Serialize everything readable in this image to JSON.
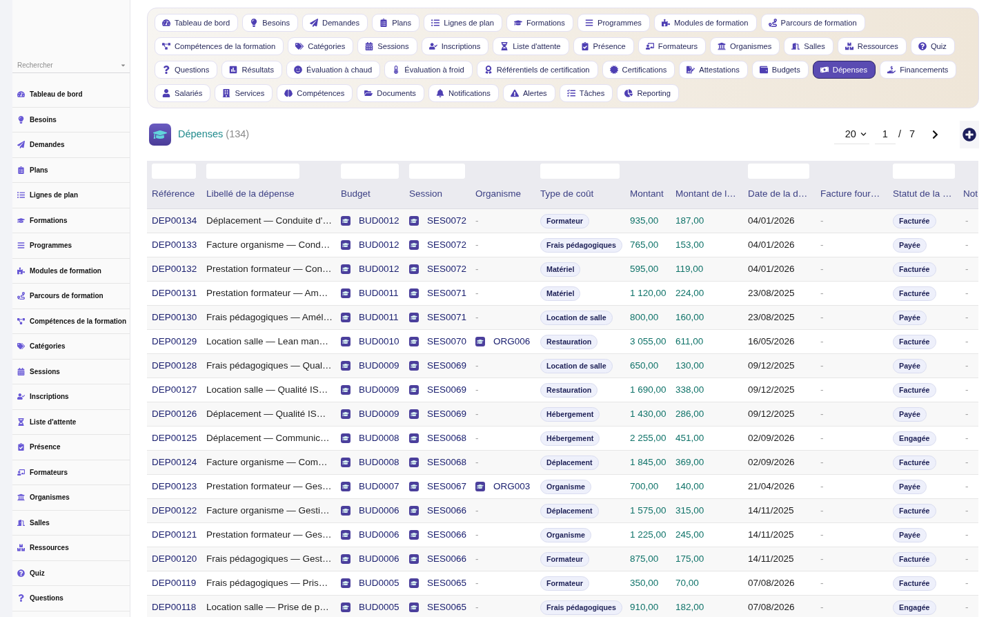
{
  "sidebar": {
    "search": {
      "placeholder": "Rechercher"
    },
    "items": [
      {
        "label": "Tableau de bord"
      },
      {
        "label": "Besoins"
      },
      {
        "label": "Demandes"
      },
      {
        "label": "Plans"
      },
      {
        "label": "Lignes de plan"
      },
      {
        "label": "Formations"
      },
      {
        "label": "Programmes"
      },
      {
        "label": "Modules de formation"
      },
      {
        "label": "Parcours de formation"
      },
      {
        "label": "Compétences de la formation"
      },
      {
        "label": "Catégories"
      },
      {
        "label": "Sessions"
      },
      {
        "label": "Inscriptions"
      },
      {
        "label": "Liste d'attente"
      },
      {
        "label": "Présence"
      },
      {
        "label": "Formateurs"
      },
      {
        "label": "Organismes"
      },
      {
        "label": "Salles"
      },
      {
        "label": "Ressources"
      },
      {
        "label": "Quiz"
      },
      {
        "label": "Questions"
      }
    ]
  },
  "nav": {
    "tabs": [
      {
        "label": "Tableau de bord",
        "selected": false
      },
      {
        "label": "Besoins",
        "selected": false
      },
      {
        "label": "Demandes",
        "selected": false
      },
      {
        "label": "Plans",
        "selected": false
      },
      {
        "label": "Lignes de plan",
        "selected": false
      },
      {
        "label": "Formations",
        "selected": false
      },
      {
        "label": "Programmes",
        "selected": false
      },
      {
        "label": "Modules de formation",
        "selected": false
      },
      {
        "label": "Parcours de formation",
        "selected": false
      },
      {
        "label": "Compétences de la formation",
        "selected": false
      },
      {
        "label": "Catégories",
        "selected": false
      },
      {
        "label": "Sessions",
        "selected": false
      },
      {
        "label": "Inscriptions",
        "selected": false
      },
      {
        "label": "Liste d'attente",
        "selected": false
      },
      {
        "label": "Présence",
        "selected": false
      },
      {
        "label": "Formateurs",
        "selected": false
      },
      {
        "label": "Organismes",
        "selected": false
      },
      {
        "label": "Salles",
        "selected": false
      },
      {
        "label": "Ressources",
        "selected": false
      },
      {
        "label": "Quiz",
        "selected": false
      },
      {
        "label": "Questions",
        "selected": false
      },
      {
        "label": "Résultats",
        "selected": false
      },
      {
        "label": "Évaluation à chaud",
        "selected": false
      },
      {
        "label": "Évaluation à froid",
        "selected": false
      },
      {
        "label": "Référentiels de certification",
        "selected": false
      },
      {
        "label": "Certifications",
        "selected": false
      },
      {
        "label": "Attestations",
        "selected": false
      },
      {
        "label": "Budgets",
        "selected": false
      },
      {
        "label": "Dépenses",
        "selected": true
      },
      {
        "label": "Financements",
        "selected": false
      },
      {
        "label": "Salariés",
        "selected": false
      },
      {
        "label": "Services",
        "selected": false
      },
      {
        "label": "Compétences",
        "selected": false
      },
      {
        "label": "Documents",
        "selected": false
      },
      {
        "label": "Notifications",
        "selected": false
      },
      {
        "label": "Alertes",
        "selected": false
      },
      {
        "label": "Tâches",
        "selected": false
      },
      {
        "label": "Reporting",
        "selected": false
      }
    ]
  },
  "header": {
    "title": "Dépenses",
    "count": "(134)"
  },
  "pagination": {
    "page_size": "20",
    "page": "1",
    "separator": "/",
    "total_pages": "7"
  },
  "table": {
    "columns": [
      {
        "label": "Référence",
        "filter": true
      },
      {
        "label": "Libellé de la dépense",
        "filter": true
      },
      {
        "label": "Budget",
        "filter": true
      },
      {
        "label": "Session",
        "filter": true
      },
      {
        "label": "Organisme",
        "filter": false
      },
      {
        "label": "Type de coût",
        "filter": true
      },
      {
        "label": "Montant",
        "filter": false
      },
      {
        "label": "Montant de l…",
        "filter": false
      },
      {
        "label": "Date de la d…",
        "filter": true
      },
      {
        "label": "Facture four…",
        "filter": false
      },
      {
        "label": "Statut de la …",
        "filter": true
      },
      {
        "label": "Not",
        "filter": false
      }
    ],
    "rows": [
      {
        "reference": "DEP00134",
        "libelle": "Déplacement — Conduite d'…",
        "budget": "BUD0012",
        "session": "SES0072",
        "organisme": {
          "text": "-",
          "linked": false
        },
        "type_de_cout": "Formateur",
        "montant": "935,00",
        "montant_de_l": "187,00",
        "date_de_la_d": "04/01/2026",
        "facture_four": "-",
        "statut": "Facturée",
        "not": "-"
      },
      {
        "reference": "DEP00133",
        "libelle": "Facture organisme — Cond…",
        "budget": "BUD0012",
        "session": "SES0072",
        "organisme": {
          "text": "-",
          "linked": false
        },
        "type_de_cout": "Frais pédagogiques",
        "montant": "765,00",
        "montant_de_l": "153,00",
        "date_de_la_d": "04/01/2026",
        "facture_four": "-",
        "statut": "Payée",
        "not": "-"
      },
      {
        "reference": "DEP00132",
        "libelle": "Prestation formateur — Con…",
        "budget": "BUD0012",
        "session": "SES0072",
        "organisme": {
          "text": "-",
          "linked": false
        },
        "type_de_cout": "Matériel",
        "montant": "595,00",
        "montant_de_l": "119,00",
        "date_de_la_d": "04/01/2026",
        "facture_four": "-",
        "statut": "Facturée",
        "not": "-"
      },
      {
        "reference": "DEP00131",
        "libelle": "Prestation formateur — Am…",
        "budget": "BUD0011",
        "session": "SES0071",
        "organisme": {
          "text": "-",
          "linked": false
        },
        "type_de_cout": "Matériel",
        "montant": "1 120,00",
        "montant_de_l": "224,00",
        "date_de_la_d": "23/08/2025",
        "facture_four": "-",
        "statut": "Facturée",
        "not": "-"
      },
      {
        "reference": "DEP00130",
        "libelle": "Frais pédagogiques — Amél…",
        "budget": "BUD0011",
        "session": "SES0071",
        "organisme": {
          "text": "-",
          "linked": false
        },
        "type_de_cout": "Location de salle",
        "montant": "800,00",
        "montant_de_l": "160,00",
        "date_de_la_d": "23/08/2025",
        "facture_four": "-",
        "statut": "Payée",
        "not": "-"
      },
      {
        "reference": "DEP00129",
        "libelle": "Location salle — Lean man…",
        "budget": "BUD0010",
        "session": "SES0070",
        "organisme": {
          "text": "ORG006",
          "linked": true
        },
        "type_de_cout": "Restauration",
        "montant": "3 055,00",
        "montant_de_l": "611,00",
        "date_de_la_d": "16/05/2026",
        "facture_four": "-",
        "statut": "Facturée",
        "not": "-"
      },
      {
        "reference": "DEP00128",
        "libelle": "Frais pédagogiques — Qual…",
        "budget": "BUD0009",
        "session": "SES0069",
        "organisme": {
          "text": "-",
          "linked": false
        },
        "type_de_cout": "Location de salle",
        "montant": "650,00",
        "montant_de_l": "130,00",
        "date_de_la_d": "09/12/2025",
        "facture_four": "-",
        "statut": "Payée",
        "not": "-"
      },
      {
        "reference": "DEP00127",
        "libelle": "Location salle — Qualité IS…",
        "budget": "BUD0009",
        "session": "SES0069",
        "organisme": {
          "text": "-",
          "linked": false
        },
        "type_de_cout": "Restauration",
        "montant": "1 690,00",
        "montant_de_l": "338,00",
        "date_de_la_d": "09/12/2025",
        "facture_four": "-",
        "statut": "Facturée",
        "not": "-"
      },
      {
        "reference": "DEP00126",
        "libelle": "Déplacement — Qualité IS…",
        "budget": "BUD0009",
        "session": "SES0069",
        "organisme": {
          "text": "-",
          "linked": false
        },
        "type_de_cout": "Hébergement",
        "montant": "1 430,00",
        "montant_de_l": "286,00",
        "date_de_la_d": "09/12/2025",
        "facture_four": "-",
        "statut": "Payée",
        "not": "-"
      },
      {
        "reference": "DEP00125",
        "libelle": "Déplacement — Communic…",
        "budget": "BUD0008",
        "session": "SES0068",
        "organisme": {
          "text": "-",
          "linked": false
        },
        "type_de_cout": "Hébergement",
        "montant": "2 255,00",
        "montant_de_l": "451,00",
        "date_de_la_d": "02/09/2026",
        "facture_four": "-",
        "statut": "Engagée",
        "not": "-"
      },
      {
        "reference": "DEP00124",
        "libelle": "Facture organisme — Com…",
        "budget": "BUD0008",
        "session": "SES0068",
        "organisme": {
          "text": "-",
          "linked": false
        },
        "type_de_cout": "Déplacement",
        "montant": "1 845,00",
        "montant_de_l": "369,00",
        "date_de_la_d": "02/09/2026",
        "facture_four": "-",
        "statut": "Facturée",
        "not": "-"
      },
      {
        "reference": "DEP00123",
        "libelle": "Prestation formateur — Ges…",
        "budget": "BUD0007",
        "session": "SES0067",
        "organisme": {
          "text": "ORG003",
          "linked": true
        },
        "type_de_cout": "Organisme",
        "montant": "700,00",
        "montant_de_l": "140,00",
        "date_de_la_d": "21/04/2026",
        "facture_four": "-",
        "statut": "Payée",
        "not": "-"
      },
      {
        "reference": "DEP00122",
        "libelle": "Facture organisme — Gesti…",
        "budget": "BUD0006",
        "session": "SES0066",
        "organisme": {
          "text": "-",
          "linked": false
        },
        "type_de_cout": "Déplacement",
        "montant": "1 575,00",
        "montant_de_l": "315,00",
        "date_de_la_d": "14/11/2025",
        "facture_four": "-",
        "statut": "Facturée",
        "not": "-"
      },
      {
        "reference": "DEP00121",
        "libelle": "Prestation formateur — Ges…",
        "budget": "BUD0006",
        "session": "SES0066",
        "organisme": {
          "text": "-",
          "linked": false
        },
        "type_de_cout": "Organisme",
        "montant": "1 225,00",
        "montant_de_l": "245,00",
        "date_de_la_d": "14/11/2025",
        "facture_four": "-",
        "statut": "Payée",
        "not": "-"
      },
      {
        "reference": "DEP00120",
        "libelle": "Frais pédagogiques — Gest…",
        "budget": "BUD0006",
        "session": "SES0066",
        "organisme": {
          "text": "-",
          "linked": false
        },
        "type_de_cout": "Formateur",
        "montant": "875,00",
        "montant_de_l": "175,00",
        "date_de_la_d": "14/11/2025",
        "facture_four": "-",
        "statut": "Facturée",
        "not": "-"
      },
      {
        "reference": "DEP00119",
        "libelle": "Frais pédagogiques — Pris…",
        "budget": "BUD0005",
        "session": "SES0065",
        "organisme": {
          "text": "-",
          "linked": false
        },
        "type_de_cout": "Formateur",
        "montant": "350,00",
        "montant_de_l": "70,00",
        "date_de_la_d": "07/08/2026",
        "facture_four": "-",
        "statut": "Facturée",
        "not": "-"
      },
      {
        "reference": "DEP00118",
        "libelle": "Location salle — Prise de p…",
        "budget": "BUD0005",
        "session": "SES0065",
        "organisme": {
          "text": "-",
          "linked": false
        },
        "type_de_cout": "Frais pédagogiques",
        "montant": "910,00",
        "montant_de_l": "182,00",
        "date_de_la_d": "07/08/2026",
        "facture_four": "-",
        "statut": "Engagée",
        "not": "-"
      }
    ]
  }
}
